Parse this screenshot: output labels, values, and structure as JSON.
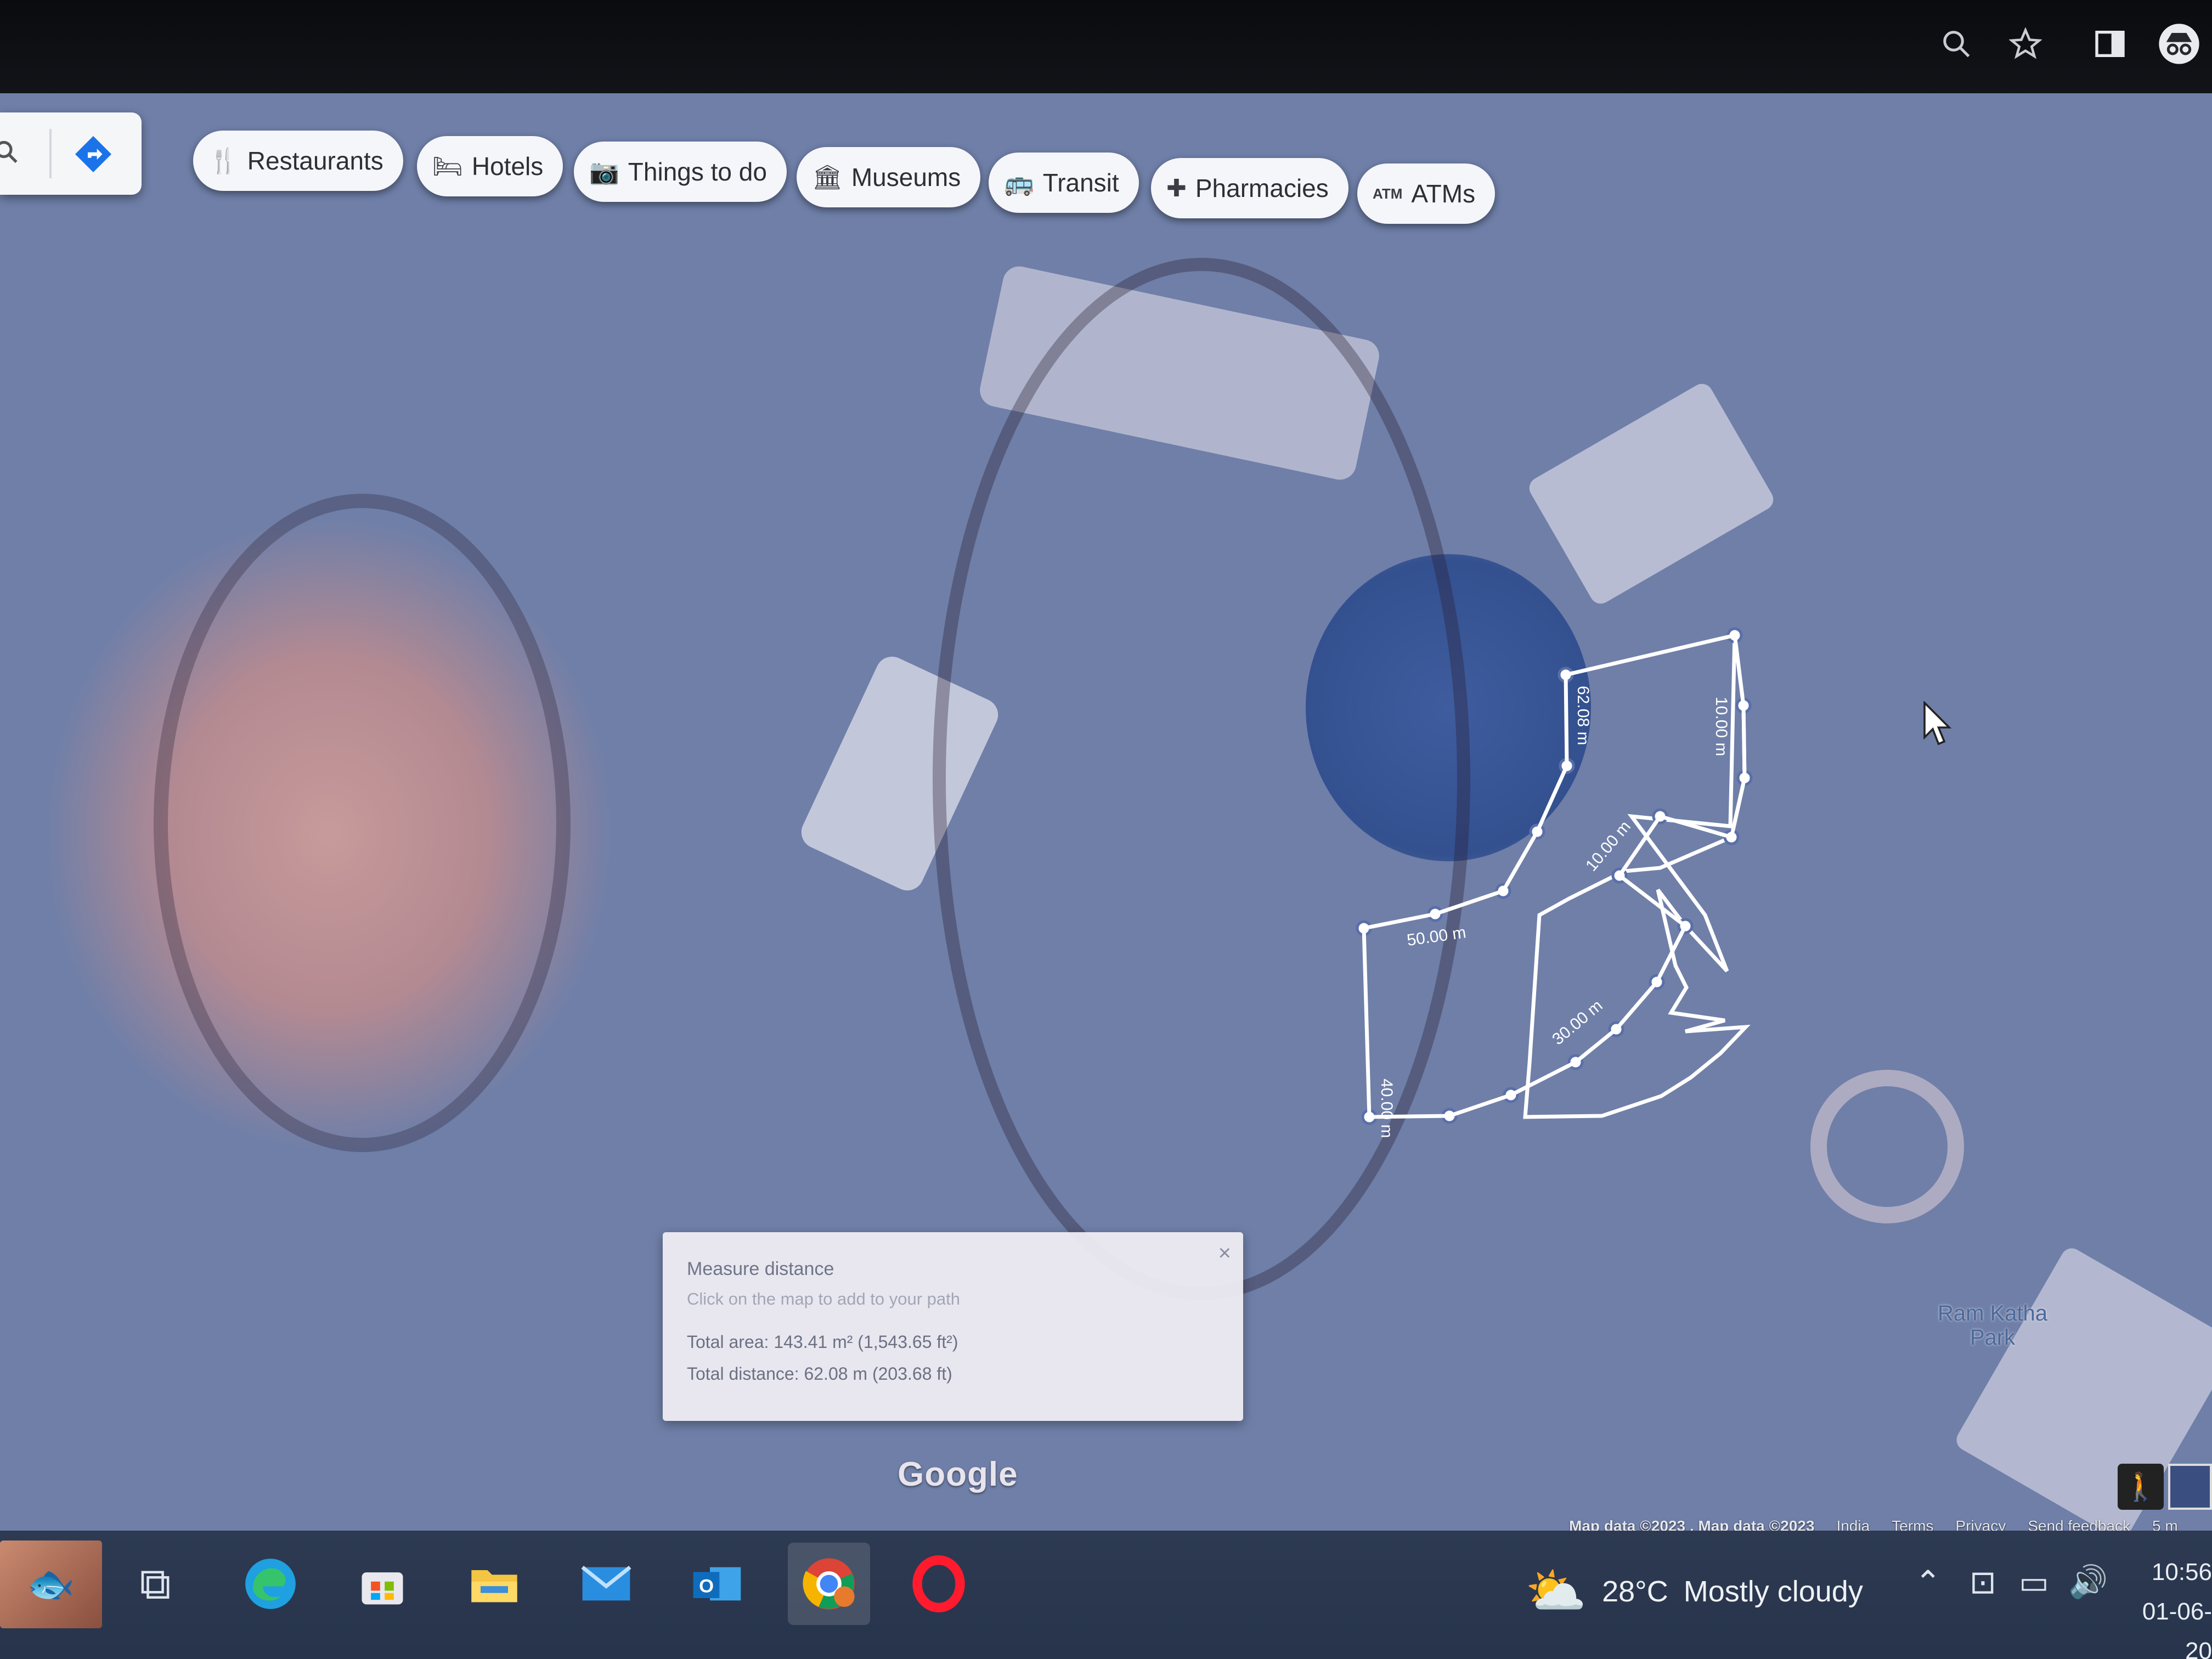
{
  "browser": {
    "icons": [
      "search-icon",
      "star-icon",
      "sidebar-icon",
      "incognito-icon"
    ]
  },
  "search": {
    "directions_icon": "directions-icon"
  },
  "categories": [
    {
      "label": "Restaurants",
      "icon": "fork-knife-icon"
    },
    {
      "label": "Hotels",
      "icon": "bed-icon"
    },
    {
      "label": "Things to do",
      "icon": "camera-icon"
    },
    {
      "label": "Museums",
      "icon": "museum-icon"
    },
    {
      "label": "Transit",
      "icon": "bus-icon"
    },
    {
      "label": "Pharmacies",
      "icon": "pharmacy-icon"
    },
    {
      "label": "ATMs",
      "icon": "atm-icon",
      "icon_text": "ATM"
    }
  ],
  "measure_labels": {
    "seg1": "62.08 m",
    "seg2": "10.00 m",
    "seg3": "10.00 m",
    "seg4": "50.00 m",
    "seg5": "30.00 m",
    "seg6": "40.00 m"
  },
  "measure_panel": {
    "title": "Measure distance",
    "hint": "Click on the map to add to your path",
    "total_area": "Total area: 143.41 m² (1,543.65 ft²)",
    "total_distance": "Total distance: 62.08 m (203.68 ft)",
    "close": "×"
  },
  "map": {
    "brand": "Google",
    "poi": "Ram Katha Park"
  },
  "attribution": {
    "map_data": "Map data ©2023 , Map data ©2023",
    "country": "India",
    "terms": "Terms",
    "privacy": "Privacy",
    "feedback": "Send feedback",
    "scale": "5 m"
  },
  "taskbar": {
    "apps": [
      "task-view-icon",
      "edge-icon",
      "store-icon",
      "explorer-icon",
      "mail-icon",
      "outlook-icon",
      "chrome-icon",
      "opera-icon"
    ],
    "outlook_letter": "O",
    "weather_temp": "28°C",
    "weather_desc": "Mostly cloudy",
    "time": "10:56",
    "date": "01-06-20"
  },
  "colors": {
    "chip_bg": "#f4f6fa",
    "taskbar_bg": "#2d3a52",
    "measure_line": "#ffffff",
    "directions_blue": "#1a73e8"
  }
}
